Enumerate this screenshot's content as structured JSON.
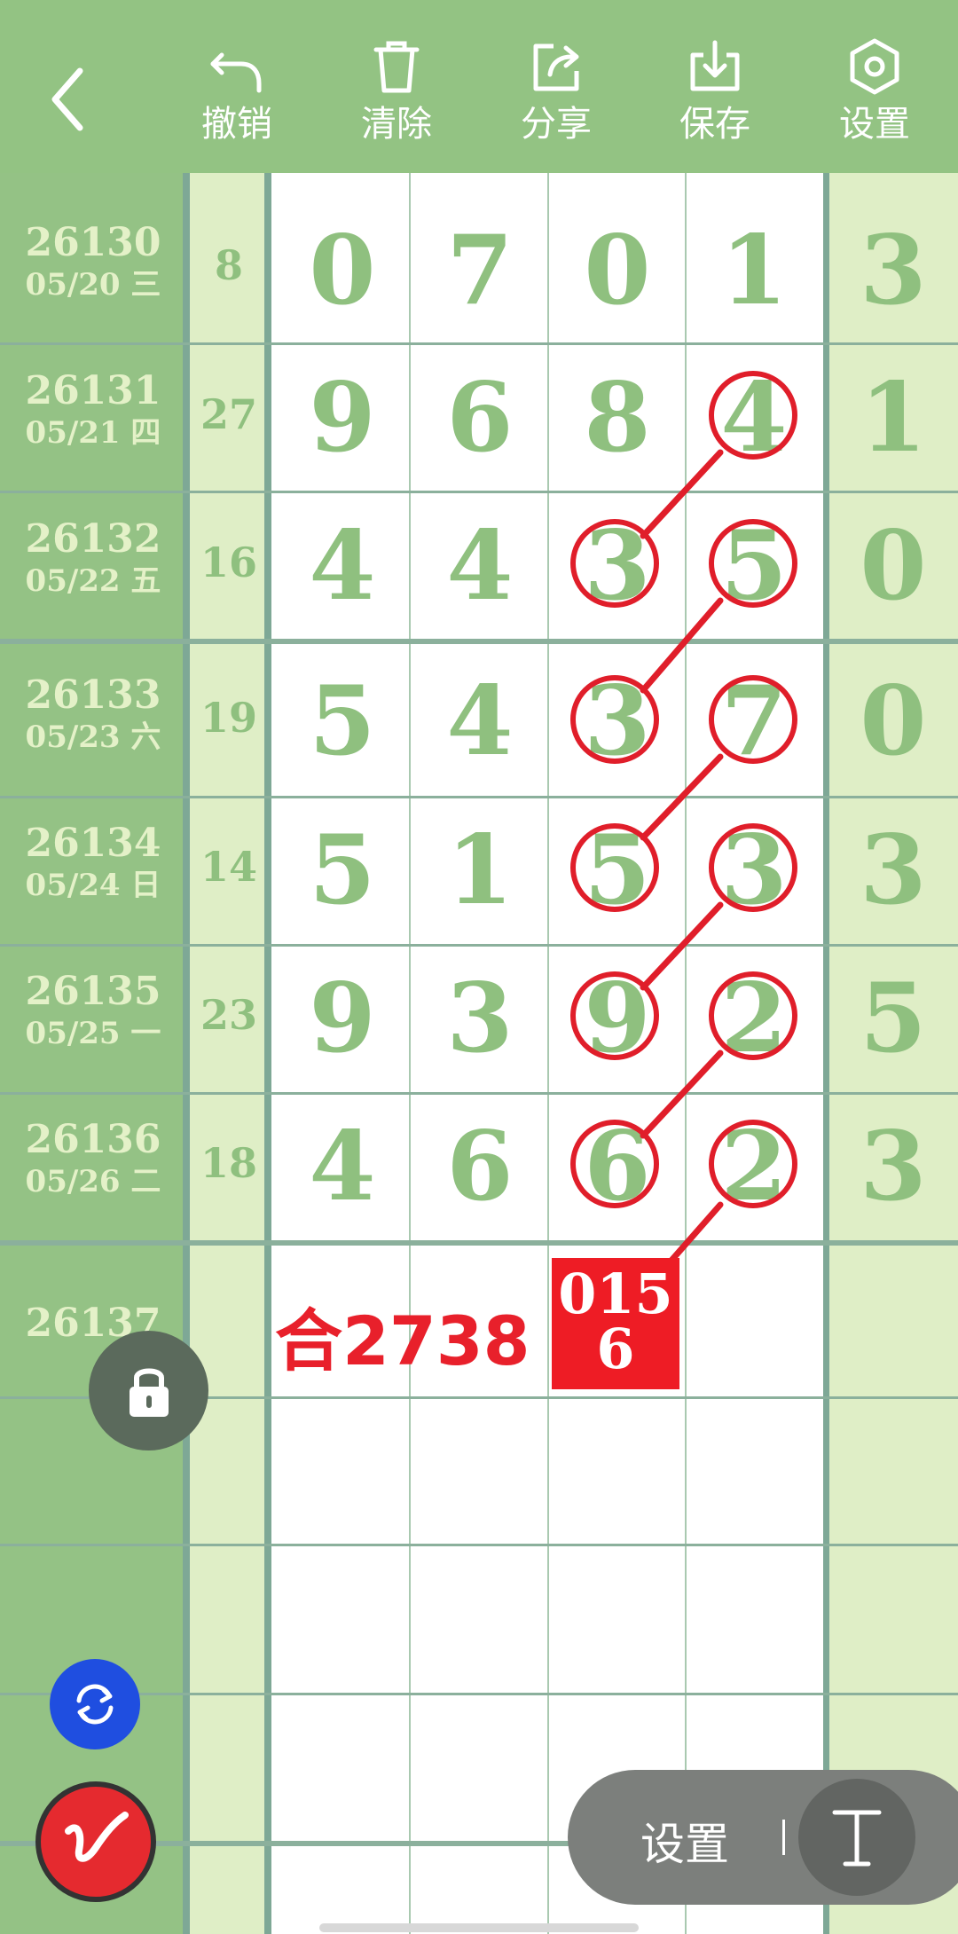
{
  "toolbar": {
    "undo": "撤销",
    "clear": "清除",
    "share": "分享",
    "save": "保存",
    "settings": "设置"
  },
  "rows": [
    {
      "period": "26130",
      "date": "05/20 三",
      "sum": "8",
      "d1": "0",
      "d2": "7",
      "d3": "0",
      "d4": "1",
      "tail": "3"
    },
    {
      "period": "26131",
      "date": "05/21 四",
      "sum": "27",
      "d1": "9",
      "d2": "6",
      "d3": "8",
      "d4": "4",
      "tail": "1"
    },
    {
      "period": "26132",
      "date": "05/22 五",
      "sum": "16",
      "d1": "4",
      "d2": "4",
      "d3": "3",
      "d4": "5",
      "tail": "0"
    },
    {
      "period": "26133",
      "date": "05/23 六",
      "sum": "19",
      "d1": "5",
      "d2": "4",
      "d3": "3",
      "d4": "7",
      "tail": "0"
    },
    {
      "period": "26134",
      "date": "05/24 日",
      "sum": "14",
      "d1": "5",
      "d2": "1",
      "d3": "5",
      "d4": "3",
      "tail": "3"
    },
    {
      "period": "26135",
      "date": "05/25 一",
      "sum": "23",
      "d1": "9",
      "d2": "3",
      "d3": "9",
      "d4": "2",
      "tail": "5"
    },
    {
      "period": "26136",
      "date": "05/26 二",
      "sum": "18",
      "d1": "4",
      "d2": "6",
      "d3": "6",
      "d4": "2",
      "tail": "3"
    }
  ],
  "next_period": "26137",
  "annotation": {
    "sum_text": "合2738",
    "box_line1": "015",
    "box_line2": "6"
  },
  "bottom_pill": {
    "settings_label": "设置"
  },
  "colors": {
    "toolbar_green": "#93c383",
    "digit_green": "#8fc07f",
    "marker_red": "#e01e2a"
  }
}
